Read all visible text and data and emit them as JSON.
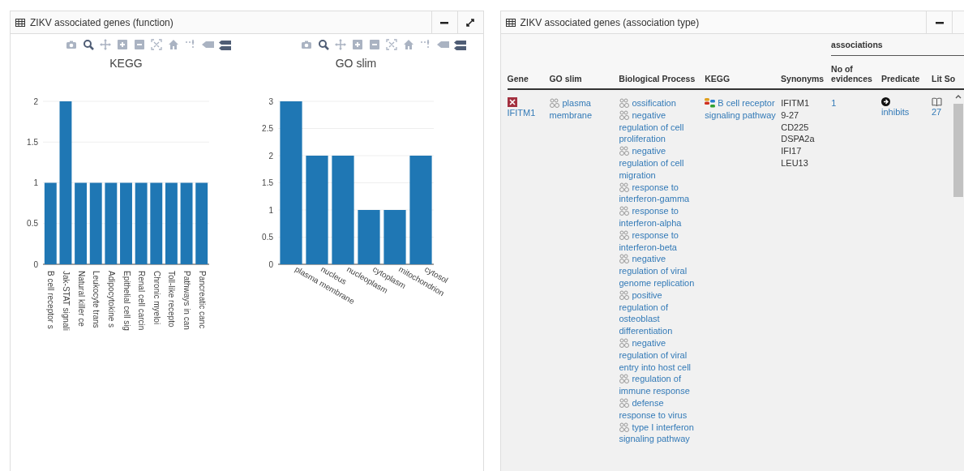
{
  "function_panel": {
    "title": "ZIKV associated genes (function)",
    "charts": [
      {
        "chart_data": {
          "type": "bar",
          "title": "KEGG",
          "categories": [
            "B cell receptor s",
            "Jak-STAT signali",
            "Natural killer ce",
            "Leukocyte trans",
            "Adipocytokine s",
            "Epithelial cell sig",
            "Renal cell carcin",
            "Chronic myeloi",
            "Toll-like recepto",
            "Pathways in can",
            "Pancreatic canc"
          ],
          "values": [
            1,
            2,
            1,
            1,
            1,
            1,
            1,
            1,
            1,
            1,
            1
          ],
          "ylim": [
            0,
            2
          ],
          "grid": true,
          "yticks": [
            0,
            0.5,
            1,
            1.5,
            2
          ]
        }
      },
      {
        "chart_data": {
          "type": "bar",
          "title": "GO slim",
          "categories": [
            "plasma membrane",
            "nucleus",
            "nucleoplasm",
            "cytoplasm",
            "mitochondrion",
            "cytosol"
          ],
          "values": [
            3,
            2,
            2,
            1,
            1,
            2
          ],
          "ylim": [
            0,
            3
          ],
          "grid": true,
          "yticks": [
            0,
            0.5,
            1,
            1.5,
            2,
            2.5,
            3
          ]
        }
      }
    ]
  },
  "association_panel": {
    "title": "ZIKV associated genes (association type)",
    "group_header": "associations",
    "columns": [
      "Gene",
      "GO slim",
      "Biological Process",
      "KEGG",
      "Synonyms",
      "No of evidences",
      "Predicate",
      "Lit So"
    ],
    "rows": [
      {
        "gene": "IFITM1",
        "go_slim": [
          "plasma membrane"
        ],
        "biological_process": [
          "ossification",
          "negative regulation of cell proliferation",
          "negative regulation of cell migration",
          "response to interferon-gamma",
          "response to interferon-alpha",
          "response to interferon-beta",
          "negative regulation of viral genome replication",
          "positive regulation of osteoblast differentiation",
          "negative regulation of viral entry into host cell",
          "regulation of immune response",
          "defense response to virus",
          "type I interferon signaling pathway"
        ],
        "kegg": [
          "B cell receptor signaling pathway"
        ],
        "synonyms": [
          "IFITM1",
          "9-27",
          "CD225",
          "DSPA2a",
          "IFI17",
          "LEU13"
        ],
        "evidences": "1",
        "predicate": "inhibits",
        "lit_source": "27"
      }
    ]
  }
}
